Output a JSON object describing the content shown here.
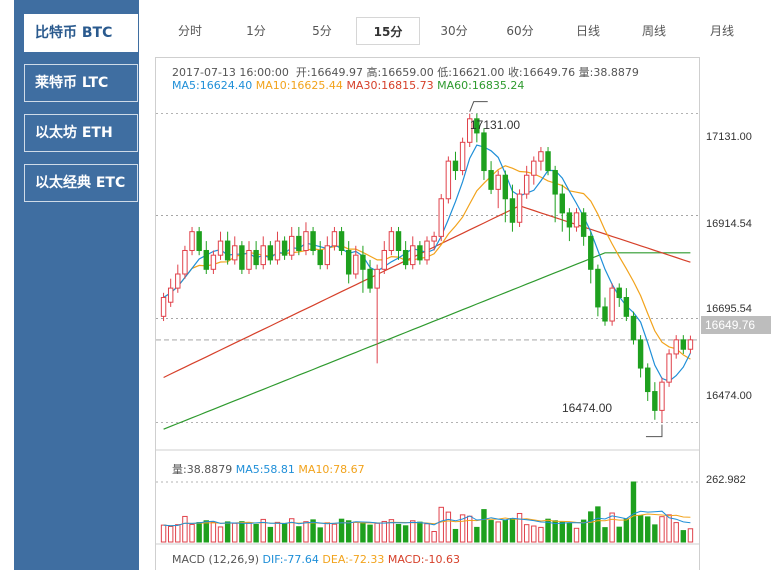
{
  "coins": [
    {
      "label": "比特币 BTC",
      "active": true
    },
    {
      "label": "莱特币 LTC",
      "active": false
    },
    {
      "label": "以太坊 ETH",
      "active": false
    },
    {
      "label": "以太经典 ETC",
      "active": false
    }
  ],
  "timeframes": [
    {
      "label": "分时",
      "active": false
    },
    {
      "label": "1分",
      "active": false
    },
    {
      "label": "5分",
      "active": false
    },
    {
      "label": "15分",
      "active": true
    },
    {
      "label": "30分",
      "active": false
    },
    {
      "label": "60分",
      "active": false
    },
    {
      "label": "日线",
      "active": false
    },
    {
      "label": "周线",
      "active": false
    },
    {
      "label": "月线",
      "active": false
    }
  ],
  "ohlc_header": {
    "timestamp": "2017-07-13 16:00:00",
    "open": "开:16649.97",
    "high": "高:16659.00",
    "low": "低:16621.00",
    "close": "收:16649.76",
    "volume": "量:38.8879"
  },
  "ma_header": {
    "ma5": "MA5:16624.40",
    "ma10": "MA10:16625.44",
    "ma30": "MA30:16815.73",
    "ma60": "MA60:16835.24"
  },
  "price_axis": {
    "ticks": [
      "17131.00",
      "16914.54",
      "16695.54",
      "16474.00"
    ],
    "current_price": "16649.76"
  },
  "annotations": {
    "high_label": "17131.00",
    "low_label": "16474.00"
  },
  "volume_header": {
    "volume": "量:38.8879",
    "ma5": "MA5:58.81",
    "ma10": "MA10:78.67"
  },
  "volume_axis": {
    "max": "262.982"
  },
  "macd_header": {
    "title": "MACD (12,26,9)",
    "dif": "DIF:-77.64",
    "dea": "DEA:-72.33",
    "macd": "MACD:-10.63"
  },
  "colors": {
    "up": "#e0424b",
    "down": "#1ea01e",
    "ma5": "#1f8fd8",
    "ma10": "#f2a31c",
    "ma30": "#d6402a",
    "ma60": "#2e9a2e",
    "sidebar": "#3f6ea1"
  },
  "chart_data": {
    "type": "candlestick",
    "interval": "15分",
    "ylim": [
      16420,
      17160
    ],
    "candles": [
      [
        16700,
        16740,
        16690,
        16750
      ],
      [
        16730,
        16760,
        16720,
        16780
      ],
      [
        16760,
        16790,
        16750,
        16810
      ],
      [
        16790,
        16840,
        16780,
        16850
      ],
      [
        16840,
        16880,
        16830,
        16890
      ],
      [
        16880,
        16840,
        16830,
        16890
      ],
      [
        16840,
        16800,
        16790,
        16860
      ],
      [
        16800,
        16830,
        16790,
        16840
      ],
      [
        16830,
        16860,
        16820,
        16880
      ],
      [
        16860,
        16820,
        16810,
        16880
      ],
      [
        16820,
        16850,
        16810,
        16870
      ],
      [
        16850,
        16800,
        16790,
        16860
      ],
      [
        16800,
        16840,
        16790,
        16860
      ],
      [
        16840,
        16810,
        16800,
        16860
      ],
      [
        16810,
        16850,
        16800,
        16870
      ],
      [
        16850,
        16820,
        16810,
        16860
      ],
      [
        16820,
        16860,
        16810,
        16880
      ],
      [
        16860,
        16830,
        16820,
        16870
      ],
      [
        16830,
        16870,
        16820,
        16890
      ],
      [
        16870,
        16840,
        16830,
        16890
      ],
      [
        16840,
        16880,
        16830,
        16900
      ],
      [
        16880,
        16840,
        16830,
        16890
      ],
      [
        16840,
        16810,
        16800,
        16860
      ],
      [
        16810,
        16850,
        16800,
        16870
      ],
      [
        16850,
        16880,
        16840,
        16890
      ],
      [
        16880,
        16840,
        16830,
        16890
      ],
      [
        16840,
        16790,
        16770,
        16860
      ],
      [
        16790,
        16830,
        16780,
        16850
      ],
      [
        16830,
        16800,
        16750,
        16850
      ],
      [
        16800,
        16760,
        16750,
        16820
      ],
      [
        16760,
        16800,
        16600,
        16810
      ],
      [
        16800,
        16840,
        16790,
        16860
      ],
      [
        16840,
        16880,
        16830,
        16890
      ],
      [
        16880,
        16840,
        16820,
        16890
      ],
      [
        16840,
        16810,
        16800,
        16860
      ],
      [
        16810,
        16850,
        16800,
        16870
      ],
      [
        16850,
        16820,
        16810,
        16860
      ],
      [
        16820,
        16860,
        16810,
        16870
      ],
      [
        16860,
        16870,
        16840,
        16880
      ],
      [
        16870,
        16950,
        16860,
        16960
      ],
      [
        16950,
        17030,
        16940,
        17040
      ],
      [
        17030,
        17010,
        16990,
        17050
      ],
      [
        17010,
        17070,
        17000,
        17080
      ],
      [
        17070,
        17120,
        17060,
        17131
      ],
      [
        17120,
        17090,
        17070,
        17131
      ],
      [
        17090,
        17010,
        16990,
        17100
      ],
      [
        17010,
        16970,
        16960,
        17030
      ],
      [
        16970,
        17000,
        16930,
        17010
      ],
      [
        17000,
        16950,
        16900,
        17010
      ],
      [
        16950,
        16900,
        16880,
        16980
      ],
      [
        16900,
        16960,
        16890,
        16970
      ],
      [
        16960,
        17000,
        16950,
        17020
      ],
      [
        17000,
        17030,
        16980,
        17040
      ],
      [
        17030,
        17050,
        17010,
        17060
      ],
      [
        17050,
        17010,
        17000,
        17060
      ],
      [
        17010,
        16960,
        16900,
        17020
      ],
      [
        16960,
        16920,
        16880,
        16980
      ],
      [
        16920,
        16890,
        16860,
        16930
      ],
      [
        16890,
        16920,
        16880,
        16930
      ],
      [
        16920,
        16870,
        16850,
        16930
      ],
      [
        16870,
        16800,
        16770,
        16880
      ],
      [
        16800,
        16720,
        16700,
        16810
      ],
      [
        16720,
        16690,
        16680,
        16740
      ],
      [
        16690,
        16760,
        16680,
        16770
      ],
      [
        16760,
        16740,
        16720,
        16770
      ],
      [
        16740,
        16700,
        16690,
        16760
      ],
      [
        16700,
        16650,
        16640,
        16710
      ],
      [
        16650,
        16590,
        16570,
        16660
      ],
      [
        16590,
        16540,
        16520,
        16600
      ],
      [
        16540,
        16500,
        16480,
        16560
      ],
      [
        16500,
        16560,
        16474,
        16570
      ],
      [
        16560,
        16620,
        16550,
        16630
      ],
      [
        16620,
        16650,
        16610,
        16660
      ],
      [
        16650,
        16630,
        16620,
        16660
      ],
      [
        16630,
        16650,
        16621,
        16659
      ]
    ]
  }
}
